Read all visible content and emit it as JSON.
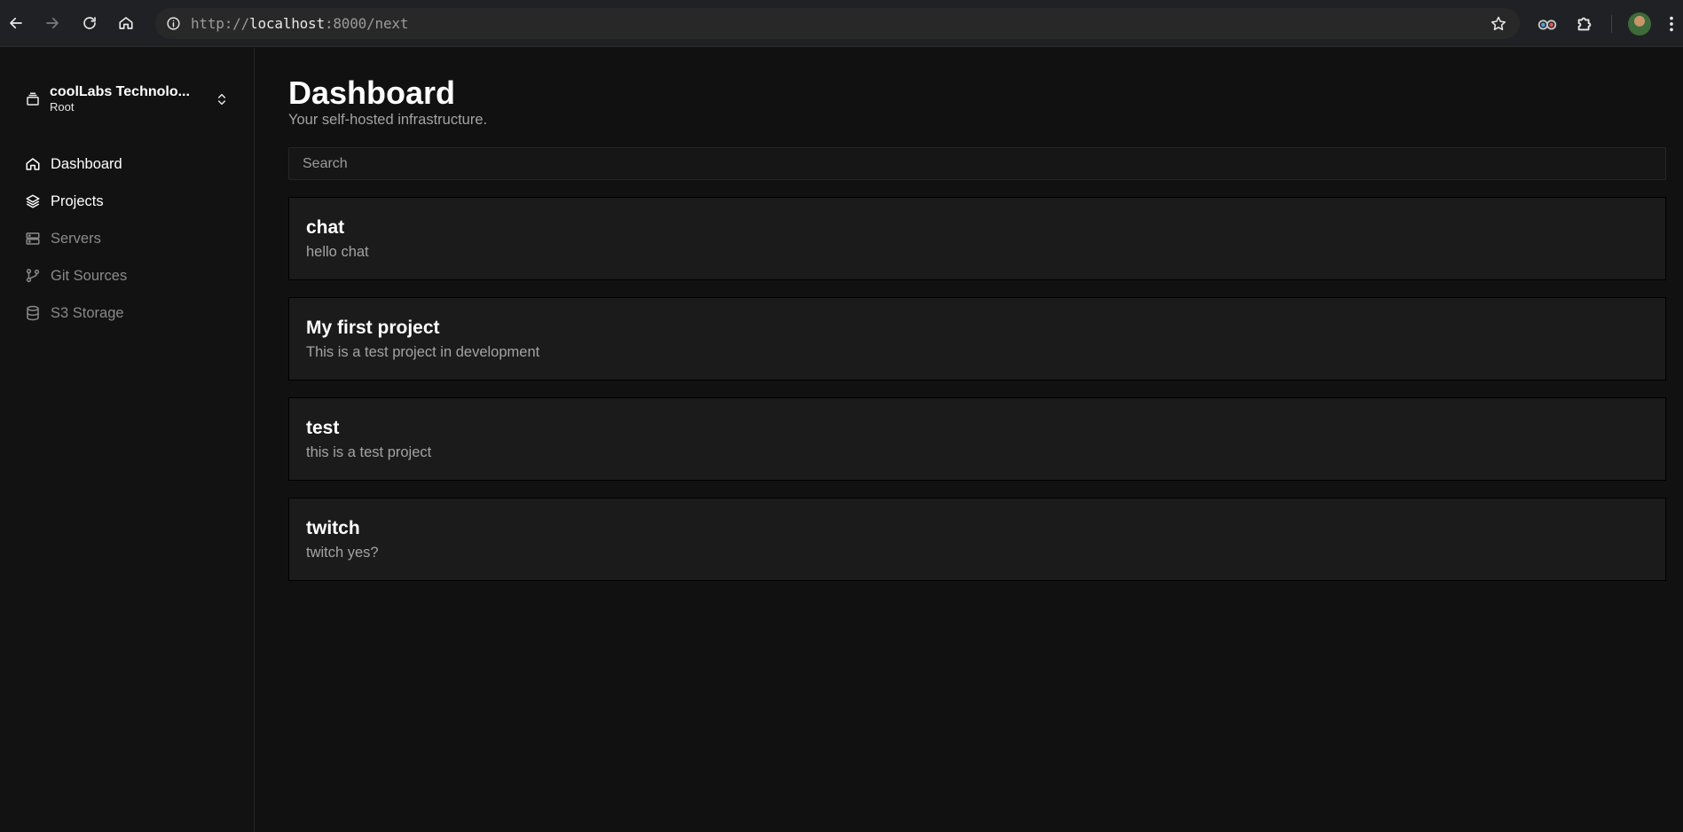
{
  "browser": {
    "url_scheme": "http://",
    "url_host": "localhost",
    "url_rest": ":8000/next",
    "icons": [
      "back-icon",
      "forward-icon",
      "reload-icon",
      "home-icon",
      "site-info-icon",
      "bookmark-star-icon",
      "extension-icon",
      "puzzle-icon",
      "avatar",
      "kebab-menu-icon"
    ]
  },
  "sidebar": {
    "team": {
      "name": "coolLabs Technolo...",
      "role": "Root"
    },
    "items": [
      {
        "label": "Dashboard",
        "icon": "home-icon",
        "state": "active"
      },
      {
        "label": "Projects",
        "icon": "layers-icon",
        "state": "active"
      },
      {
        "label": "Servers",
        "icon": "server-icon",
        "state": "muted"
      },
      {
        "label": "Git Sources",
        "icon": "git-branch-icon",
        "state": "muted"
      },
      {
        "label": "S3 Storage",
        "icon": "database-icon",
        "state": "muted"
      }
    ]
  },
  "main": {
    "title": "Dashboard",
    "subtitle": "Your self-hosted infrastructure.",
    "search_placeholder": "Search",
    "projects": [
      {
        "name": "chat",
        "description": "hello chat"
      },
      {
        "name": "My first project",
        "description": "This is a test project in development"
      },
      {
        "name": "test",
        "description": "this is a test project"
      },
      {
        "name": "twitch",
        "description": "twitch yes?"
      }
    ]
  },
  "colors": {
    "background": "#111111",
    "card": "#1b1b1b",
    "muted_text": "#a3a3a3",
    "nav_muted": "#8a8a8a"
  }
}
